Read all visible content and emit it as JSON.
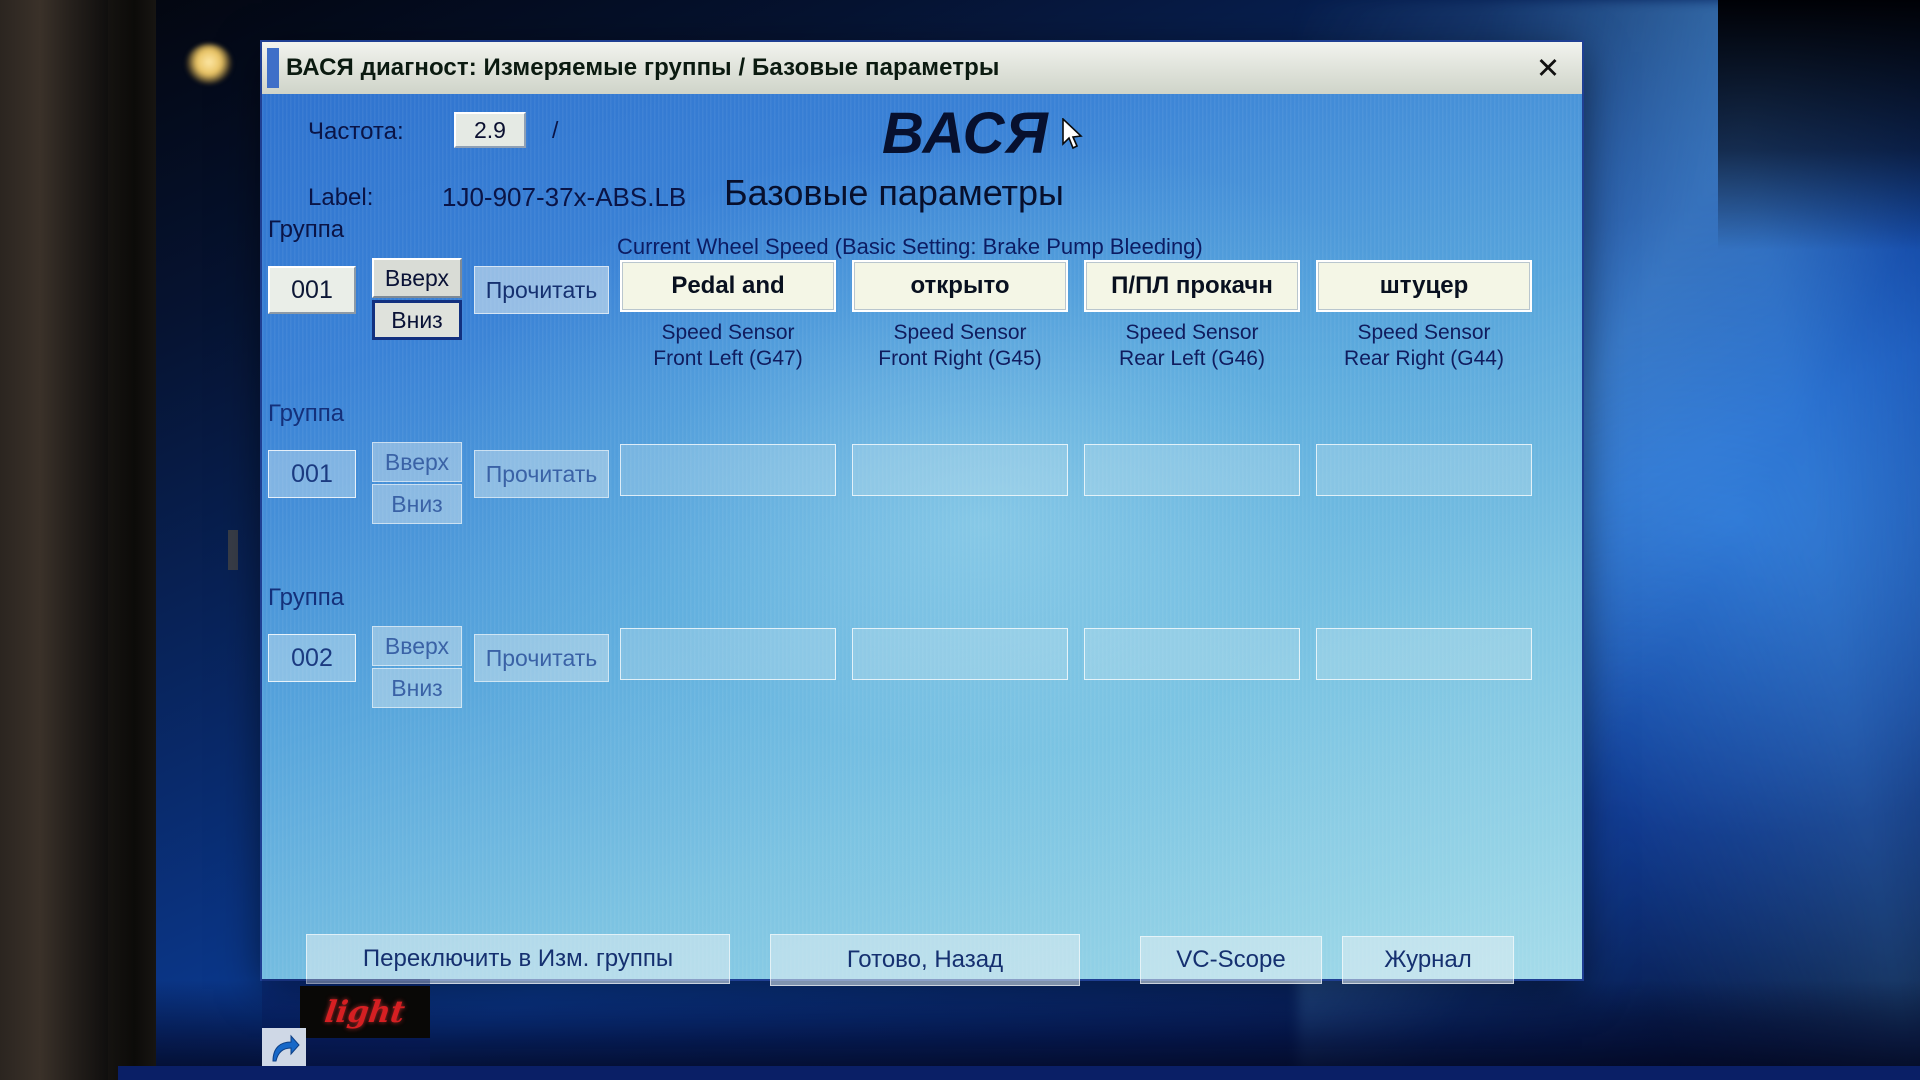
{
  "window": {
    "title": "ВАСЯ диагност: Измеряемые группы / Базовые параметры",
    "close_icon": "close-icon",
    "close_glyph": "✕"
  },
  "logo": {
    "brand": "ВАСЯ",
    "subtitle": "Базовые параметры"
  },
  "info": {
    "rate_label": "Частота:",
    "rate_value": "2.9",
    "rate_separator": "/",
    "label_label": "Label:",
    "label_value": "1J0-907-37x-ABS.LB"
  },
  "section_header": "Current Wheel Speed (Basic Setting: Brake Pump Bleeding)",
  "group_caption": "Группа",
  "buttons": {
    "up": "Вверх",
    "down": "Вниз",
    "read": "Прочитать"
  },
  "rows": [
    {
      "group_number": "001",
      "enabled": true,
      "fields": [
        "Pedal and",
        "открыто",
        "П/ПЛ прокачн",
        "штуцер"
      ],
      "captions": [
        {
          "line1": "Speed Sensor",
          "line2": "Front Left (G47)"
        },
        {
          "line1": "Speed Sensor",
          "line2": "Front Right (G45)"
        },
        {
          "line1": "Speed Sensor",
          "line2": "Rear Left (G46)"
        },
        {
          "line1": "Speed Sensor",
          "line2": "Rear Right (G44)"
        }
      ]
    },
    {
      "group_number": "001",
      "enabled": false,
      "fields": [
        "",
        "",
        "",
        ""
      ],
      "captions": [
        {
          "line1": "",
          "line2": ""
        },
        {
          "line1": "",
          "line2": ""
        },
        {
          "line1": "",
          "line2": ""
        },
        {
          "line1": "",
          "line2": ""
        }
      ]
    },
    {
      "group_number": "002",
      "enabled": false,
      "fields": [
        "",
        "",
        "",
        ""
      ],
      "captions": [
        {
          "line1": "",
          "line2": ""
        },
        {
          "line1": "",
          "line2": ""
        },
        {
          "line1": "",
          "line2": ""
        },
        {
          "line1": "",
          "line2": ""
        }
      ]
    }
  ],
  "footer": {
    "switch_to_meas": "Переключить в Изм. группы",
    "done_back": "Готово, Назад",
    "vc_scope": "VC-Scope",
    "journal": "Журнал"
  },
  "desktop": {
    "light_logo_text": "light",
    "shortcut_icon": "shortcut-arrow-icon"
  },
  "colors": {
    "titlebar": "#e2e5dd",
    "dialog_blue": "#3b7fd4",
    "field_active_bg": "#f4f6e6",
    "focus_border": "#12307f",
    "text_dark": "#0a1446"
  }
}
